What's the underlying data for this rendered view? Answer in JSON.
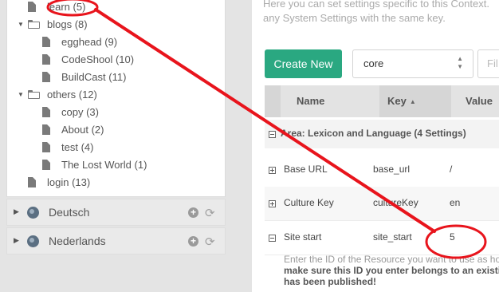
{
  "tree": {
    "items": [
      {
        "label": "learn (5)",
        "kind": "doc"
      },
      {
        "label": "blogs (8)",
        "kind": "folder"
      },
      {
        "label": "egghead (9)",
        "kind": "doc"
      },
      {
        "label": "CodeShool (10)",
        "kind": "doc"
      },
      {
        "label": "BuildCast (11)",
        "kind": "doc"
      },
      {
        "label": "others (12)",
        "kind": "folder"
      },
      {
        "label": "copy (3)",
        "kind": "doc"
      },
      {
        "label": "About (2)",
        "kind": "doc"
      },
      {
        "label": "test (4)",
        "kind": "doc"
      },
      {
        "label": "The Lost World (1)",
        "kind": "doc"
      },
      {
        "label": "login (13)",
        "kind": "doc"
      }
    ]
  },
  "contexts": [
    {
      "label": "Deutsch"
    },
    {
      "label": "Nederlands"
    }
  ],
  "settings": {
    "intro": "Here you can set settings specific to this Context. any System Settings with the same key.",
    "create_button": "Create New",
    "area_select_value": "core",
    "filter_placeholder": "Fil",
    "columns": {
      "name": "Name",
      "key": "Key",
      "value": "Value"
    },
    "group_label": "Area: Lexicon and Language (4 Settings)",
    "rows": [
      {
        "name": "Base URL",
        "key": "base_url",
        "value": "/"
      },
      {
        "name": "Culture Key",
        "key": "cultureKey",
        "value": "en"
      },
      {
        "name": "Site start",
        "key": "site_start",
        "value": "5"
      }
    ],
    "description": "Enter the ID of the Resource you want to use as ho",
    "description_bold": "make sure this ID you enter belongs to an existi has been published!"
  },
  "colors": {
    "accent_green": "#2aa881",
    "annotation_red": "#e8141c"
  },
  "icons": [
    "document-icon",
    "folder-open-icon",
    "globe-icon",
    "plus-circle-icon",
    "refresh-icon",
    "sort-up-icon",
    "expand-icon",
    "collapse-icon",
    "select-arrows-icon"
  ]
}
